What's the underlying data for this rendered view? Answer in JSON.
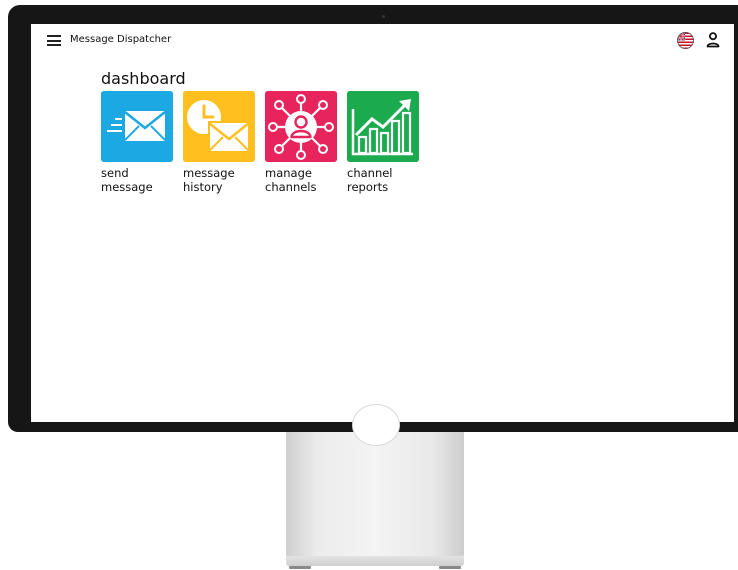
{
  "app": {
    "title": "Message Dispatcher"
  },
  "header": {
    "icons": [
      "menu-icon",
      "flag-icon",
      "user-icon"
    ]
  },
  "dashboard": {
    "title": "dashboard",
    "tiles": [
      {
        "line1": "send",
        "line2": "message",
        "icon": "envelope-icon",
        "color": "#1CA8E3"
      },
      {
        "line1": "message",
        "line2": "history",
        "icon": "clock-envelope-icon",
        "color": "#FFBF1F"
      },
      {
        "line1": "manage",
        "line2": "channels",
        "icon": "network-user-icon",
        "color": "#E8245C"
      },
      {
        "line1": "channel",
        "line2": "reports",
        "icon": "bar-chart-icon",
        "color": "#1BAB4E"
      }
    ]
  }
}
